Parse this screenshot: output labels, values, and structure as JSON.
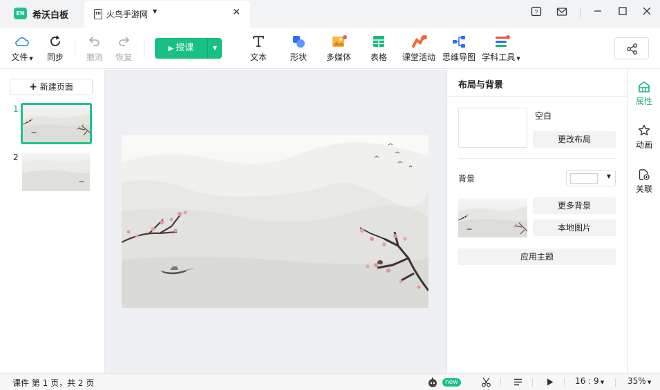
{
  "app": {
    "name": "希沃白板",
    "logo_text": "EN"
  },
  "tab": {
    "icon_text": "EN",
    "title": "火鸟手游网"
  },
  "toolbar": {
    "file": "文件",
    "sync": "同步",
    "undo": "撤消",
    "redo": "恢复",
    "teach": "授课",
    "text": "文本",
    "shape": "形状",
    "media": "多媒体",
    "table": "表格",
    "activity": "课堂活动",
    "mindmap": "思维导图",
    "subject_tools": "学科工具"
  },
  "left_panel": {
    "new_page": "新建页面",
    "pages": [
      {
        "num": "1",
        "selected": true
      },
      {
        "num": "2",
        "selected": false
      }
    ]
  },
  "right_panel": {
    "title": "布局与背景",
    "layout_name": "空白",
    "change_layout": "更改布局",
    "background_label": "背景",
    "background_color": "#ffffff",
    "more_backgrounds": "更多背景",
    "local_image": "本地图片",
    "apply_theme": "应用主题"
  },
  "side_tabs": [
    {
      "label": "属性",
      "icon": "layout-icon",
      "active": true
    },
    {
      "label": "动画",
      "icon": "star-icon",
      "active": false
    },
    {
      "label": "关联",
      "icon": "link-icon",
      "active": false
    }
  ],
  "status": {
    "page_info": "课件 第 1 页，共 2 页",
    "new_badge": "new",
    "ratio": "16 : 9",
    "zoom": "35%"
  },
  "colors": {
    "accent": "#19c083",
    "accent_dark": "#0fa56f"
  }
}
